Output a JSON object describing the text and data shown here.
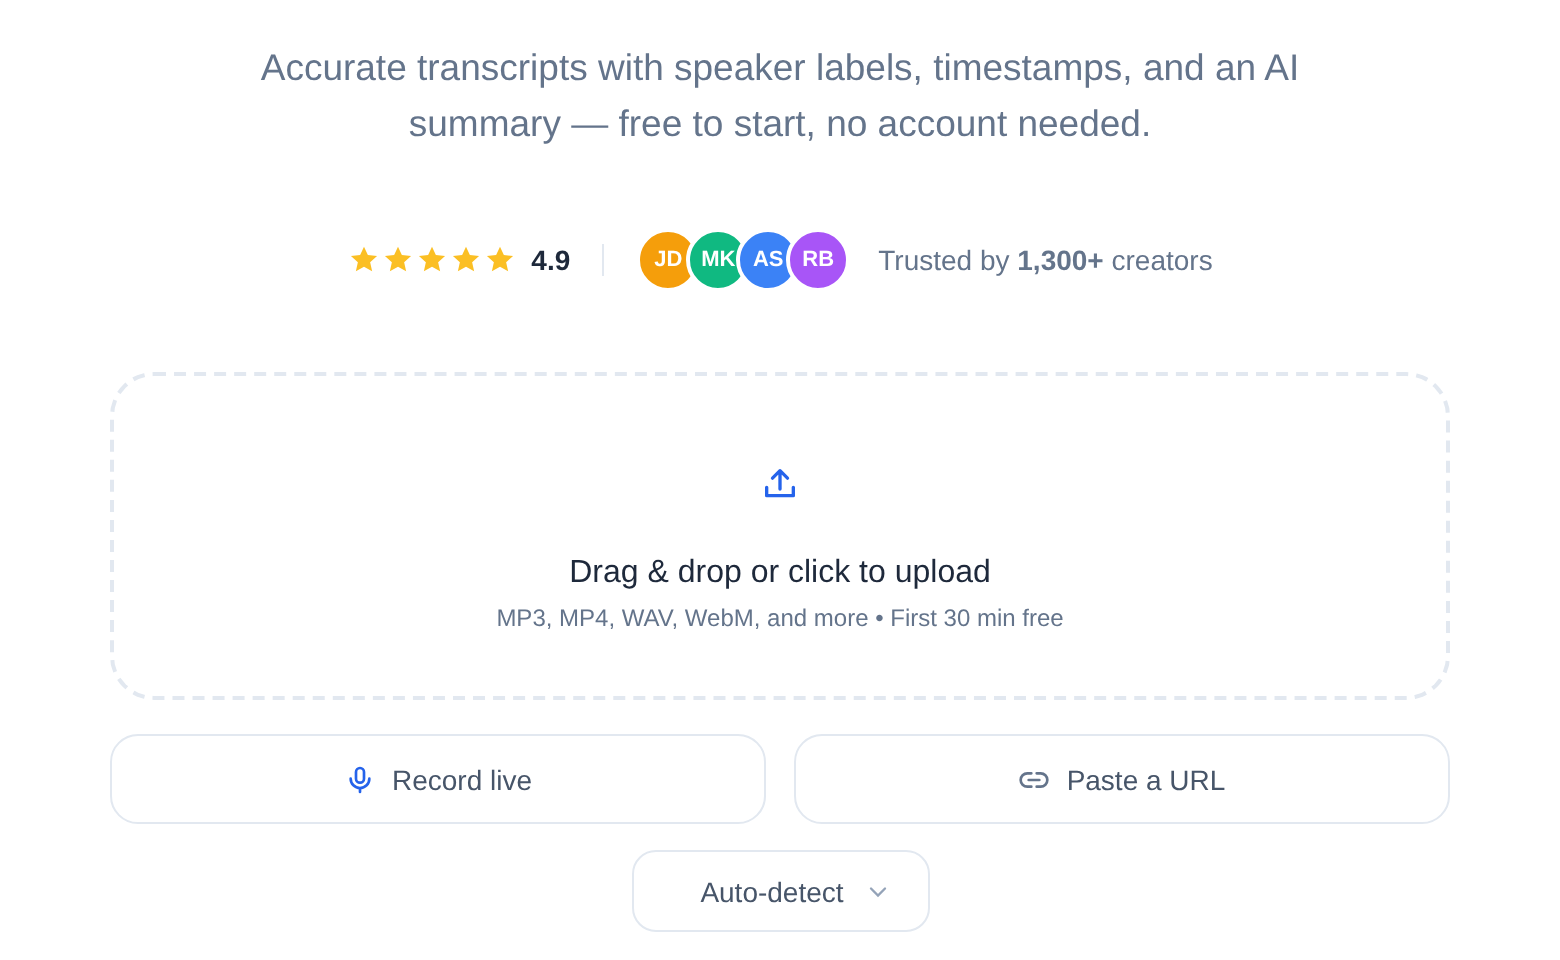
{
  "subtitle": "Accurate transcripts with speaker labels, timestamps, and an AI summary — free to start, no account needed.",
  "rating": {
    "stars": 5,
    "score": "4.9"
  },
  "avatars": [
    {
      "initials": "JD",
      "color": "#f59e0b"
    },
    {
      "initials": "MK",
      "color": "#10b981"
    },
    {
      "initials": "AS",
      "color": "#3b82f6"
    },
    {
      "initials": "RB",
      "color": "#a855f7"
    }
  ],
  "trust_text": "Trusted by **1,300+** creators",
  "dropzone": {
    "title": "Drag & drop or click to upload",
    "hint": "MP3, MP4, WAV, WebM, and more • First 30 min free"
  },
  "actions": [
    {
      "kind": "mic",
      "label": "Record live"
    },
    {
      "kind": "link",
      "label": "Paste a URL"
    }
  ],
  "language_select": {
    "value": "Auto-detect"
  }
}
